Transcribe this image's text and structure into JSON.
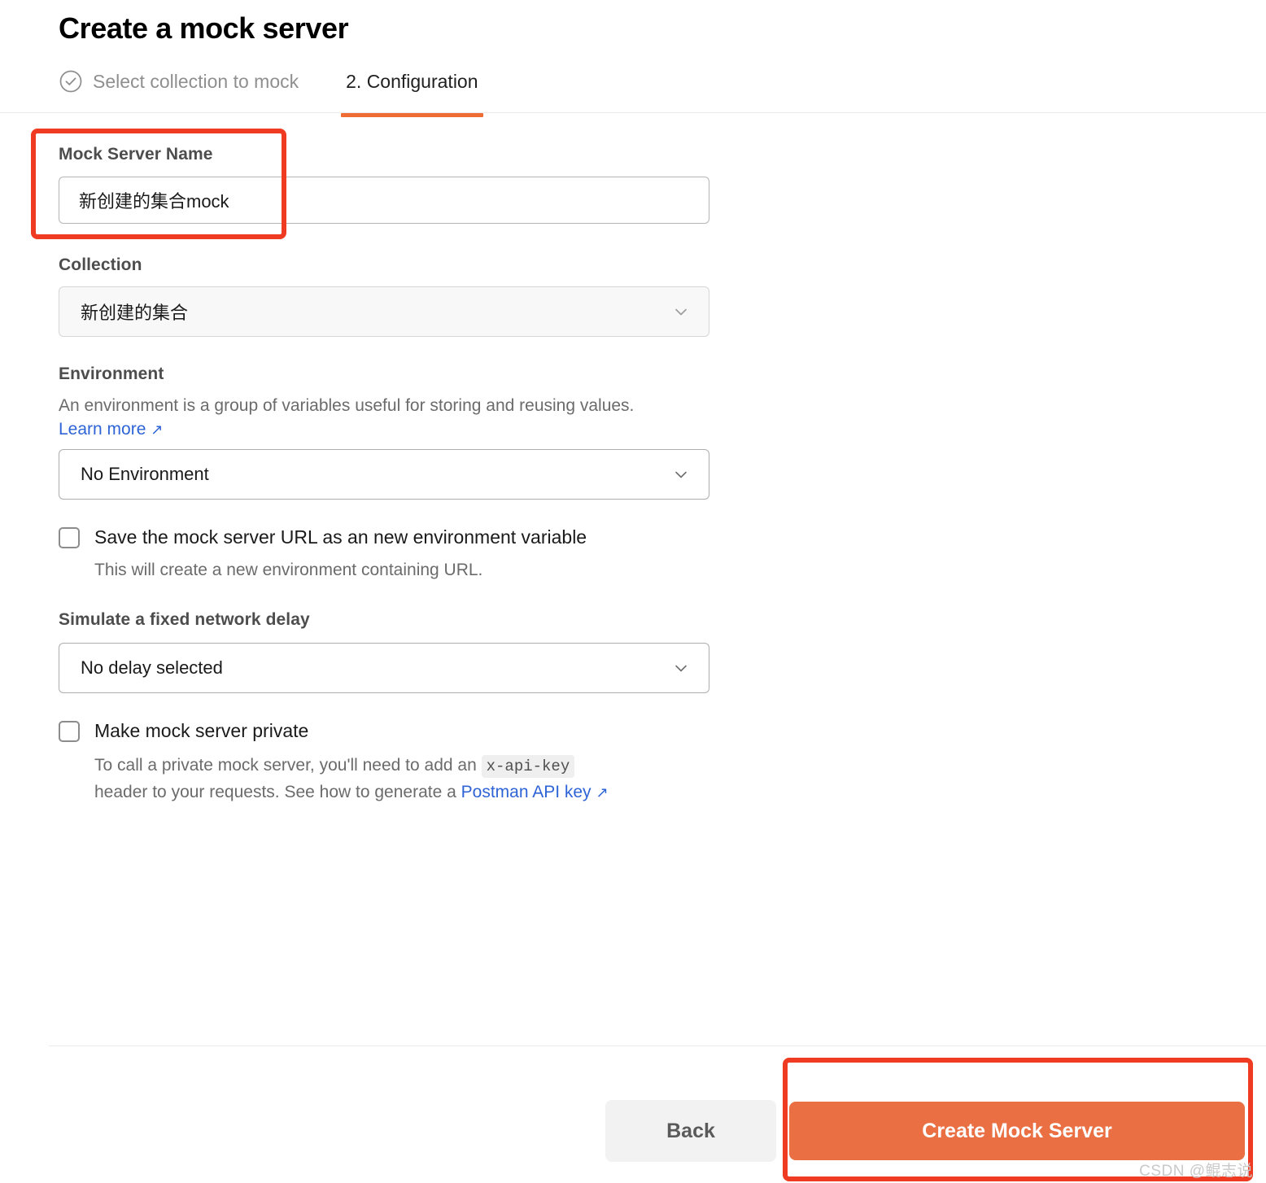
{
  "header": {
    "title": "Create a mock server",
    "steps": [
      {
        "label": "Select collection to mock",
        "icon": "check-circle-icon",
        "state": "completed"
      },
      {
        "label": "2. Configuration",
        "state": "current"
      }
    ]
  },
  "form": {
    "mock_server_name": {
      "label": "Mock Server Name",
      "value": "新创建的集合mock",
      "placeholder": "Mock Server Name"
    },
    "collection": {
      "label": "Collection",
      "value": "新创建的集合",
      "chevron": "chevron-down-icon"
    },
    "environment": {
      "label": "Environment",
      "description": "An environment is a group of variables useful for storing and reusing values.",
      "learn_more": "Learn more",
      "external_arrow": "↗",
      "value": "No Environment",
      "chevron": "chevron-down-icon"
    },
    "save_url_checkbox": {
      "label": "Save the mock server URL as an new environment variable",
      "sub": "This will create a new environment containing URL.",
      "checked": false
    },
    "delay": {
      "label": "Simulate a fixed network delay",
      "value": "No delay selected",
      "chevron": "chevron-down-icon"
    },
    "private_checkbox": {
      "label": "Make mock server private",
      "sub_part1": "To call a private mock server, you'll need to add an ",
      "code": "x-api-key",
      "sub_part2": "header to your requests. See how to generate a ",
      "link": "Postman API key",
      "external_arrow": "↗",
      "checked": false
    }
  },
  "footer": {
    "back_label": "Back",
    "create_label": "Create Mock Server"
  },
  "annotations": {
    "color": "#ef3b21",
    "boxes": [
      "mock-server-name-field",
      "create-mock-server-button"
    ]
  },
  "watermark": "CSDN @鲲志说",
  "colors": {
    "accent_orange": "#ea7044",
    "tab_underline": "#ef6c35",
    "link_blue": "#2f64d6",
    "annotation_red": "#ef3b21"
  }
}
